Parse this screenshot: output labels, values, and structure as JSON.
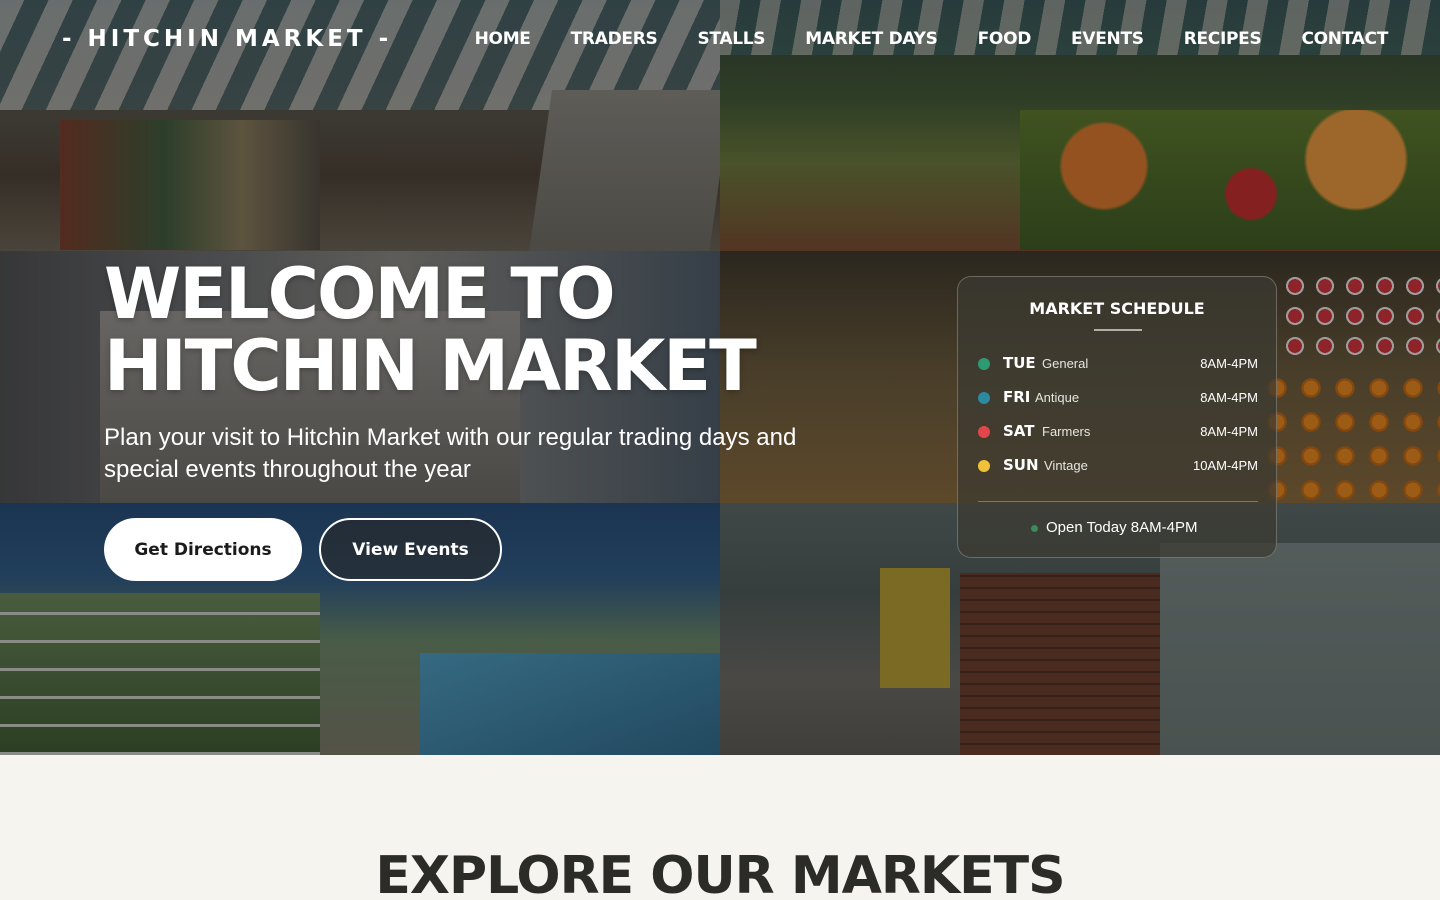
{
  "nav": {
    "logo": "- HITCHIN MARKET -",
    "links": [
      "HOME",
      "TRADERS",
      "STALLS",
      "MARKET DAYS",
      "FOOD",
      "EVENTS",
      "RECIPES",
      "CONTACT"
    ]
  },
  "hero": {
    "title_line1": "WELCOME TO",
    "title_line2": "HITCHIN MARKET",
    "subtitle": "Plan your visit to Hitchin Market with our regular trading days and special events throughout the year",
    "primary_button": "Get Directions",
    "secondary_button": "View Events"
  },
  "schedule": {
    "title": "MARKET SCHEDULE",
    "rows": [
      {
        "day": "TUE",
        "type": "General",
        "hours": "8AM-4PM",
        "color": "#2e9a72"
      },
      {
        "day": "FRI",
        "type": "Antique",
        "hours": "8AM-4PM",
        "color": "#2b8aa0"
      },
      {
        "day": "SAT",
        "type": "Farmers",
        "hours": "8AM-4PM",
        "color": "#e0474a"
      },
      {
        "day": "SUN",
        "type": "Vintage",
        "hours": "10AM-4PM",
        "color": "#f0c23a"
      }
    ],
    "status": "Open Today 8AM-4PM",
    "status_color": "#3a8a5a"
  },
  "section": {
    "title": "EXPLORE OUR MARKETS"
  },
  "colors": {
    "page_bg": "#f6f4ee",
    "heading_dark": "#2b2b28"
  }
}
